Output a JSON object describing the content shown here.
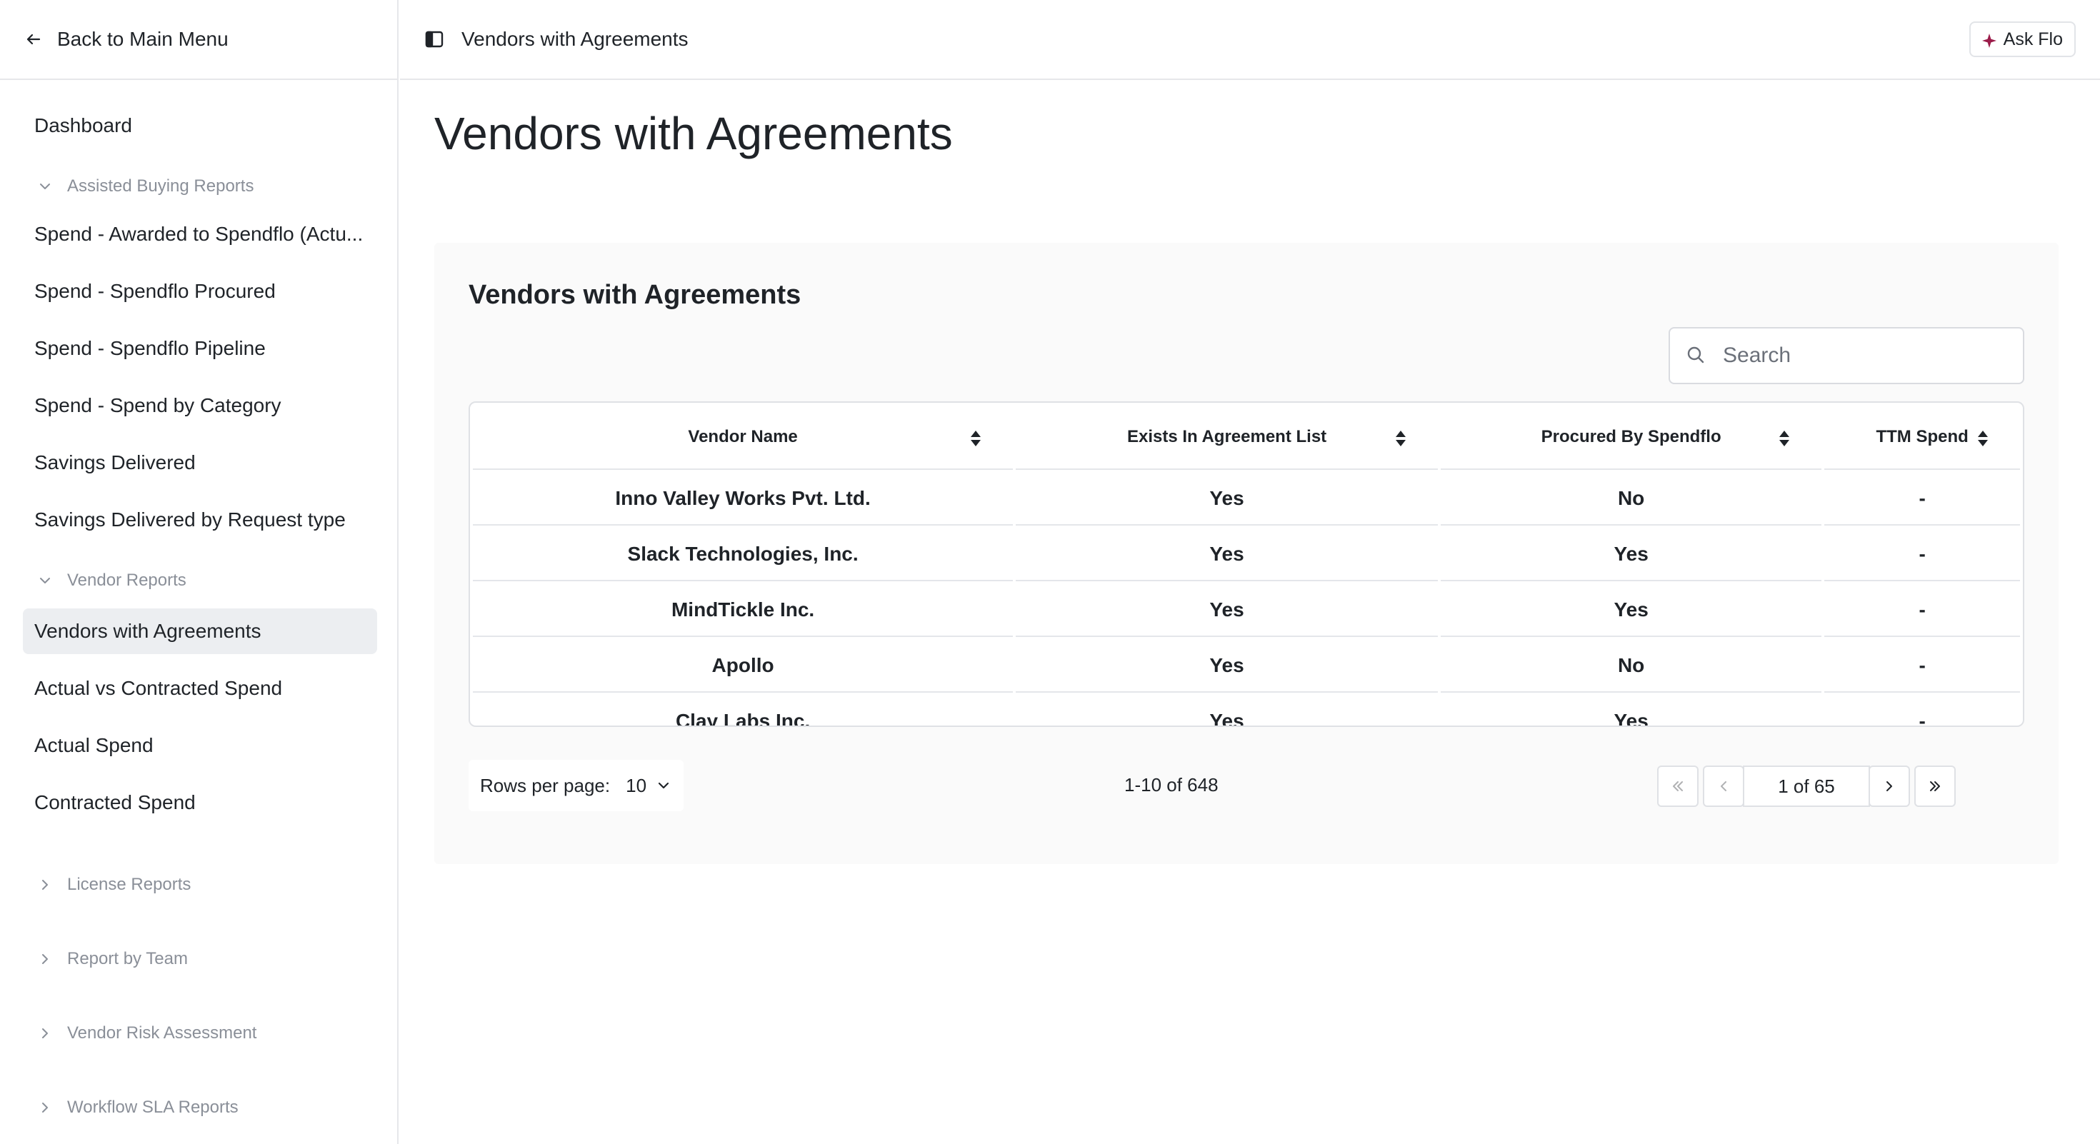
{
  "sidebar": {
    "back_label": "Back to Main Menu",
    "dashboard": "Dashboard",
    "groups": {
      "assisted": {
        "label": "Assisted Buying Reports",
        "items": [
          "Spend - Awarded to Spendflo (Actu...",
          "Spend - Spendflo Procured",
          "Spend - Spendflo Pipeline",
          "Spend - Spend by Category",
          "Savings Delivered",
          "Savings Delivered by Request type"
        ]
      },
      "vendor": {
        "label": "Vendor Reports",
        "items": [
          "Vendors with Agreements",
          "Actual vs Contracted Spend",
          "Actual Spend",
          "Contracted Spend"
        ],
        "active_index": 0
      },
      "license": {
        "label": "License Reports"
      },
      "team": {
        "label": "Report by Team"
      },
      "risk": {
        "label": "Vendor Risk Assessment"
      },
      "sla": {
        "label": "Workflow SLA Reports"
      }
    }
  },
  "topbar": {
    "breadcrumb": "Vendors with Agreements",
    "ask_label": "Ask Flo"
  },
  "page": {
    "title": "Vendors with Agreements",
    "card_title": "Vendors with Agreements"
  },
  "search": {
    "placeholder": "Search",
    "value": ""
  },
  "table": {
    "columns": [
      "Vendor Name",
      "Exists In Agreement List",
      "Procured By Spendflo",
      "TTM Spend"
    ],
    "rows": [
      [
        "Inno Valley Works Pvt. Ltd.",
        "Yes",
        "No",
        "-"
      ],
      [
        "Slack Technologies, Inc.",
        "Yes",
        "Yes",
        "-"
      ],
      [
        "MindTickle Inc.",
        "Yes",
        "Yes",
        "-"
      ],
      [
        "Apollo",
        "Yes",
        "No",
        "-"
      ],
      [
        "Clay Labs Inc.",
        "Yes",
        "Yes",
        "-"
      ]
    ]
  },
  "pagination": {
    "rows_per_page_label": "Rows per page:",
    "rows_per_page": "10",
    "range": "1-10 of 648",
    "page_indicator": "1 of 65"
  },
  "colors": {
    "accent": "#9b1c4a",
    "active_bg": "#eceef1",
    "muted": "#8a8f98"
  }
}
